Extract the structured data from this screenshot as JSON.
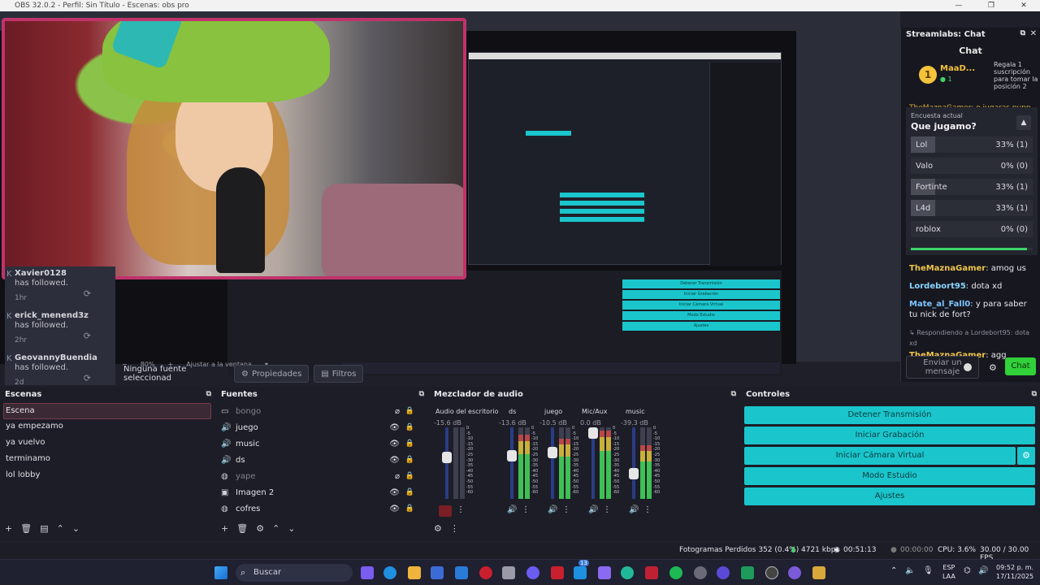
{
  "window": {
    "title": "OBS 32.0.2 - Perfil: Sin Título - Escenas: obs pro",
    "controls": [
      "—",
      "❐",
      "✕"
    ]
  },
  "preview": {
    "zoom": "80%",
    "fit_label": "Ajustar a la ventana"
  },
  "alerts": [
    {
      "name": "Xavier0128",
      "text": "has followed.",
      "ago": "1hr"
    },
    {
      "name": "erick_menend3z",
      "text": "has followed.",
      "ago": "2hr"
    },
    {
      "name": "GeovannyBuendia",
      "text": "has followed.",
      "ago": "2d"
    }
  ],
  "source_bar": {
    "no_source": "Ninguna fuente seleccionad",
    "properties": "Propiedades",
    "filters": "Filtros"
  },
  "chat": {
    "dock_title": "Streamlabs: Chat",
    "title": "Chat",
    "pinned": {
      "name": "MaaD...",
      "count": "1",
      "reward": "Regala 1 suscripción para tomar la posición 2"
    },
    "partial_line": "TheMaznaGamer: o jugaras puppy",
    "poll": {
      "label": "Encuesta actual",
      "question": "Que jugamo?",
      "options": [
        {
          "name": "Lol",
          "value": "33% (1)",
          "pct": 33
        },
        {
          "name": "Valo",
          "value": "0% (0)",
          "pct": 0
        },
        {
          "name": "Fortinte",
          "value": "33% (1)",
          "pct": 33
        },
        {
          "name": "L4d",
          "value": "33% (1)",
          "pct": 33
        },
        {
          "name": "roblox",
          "value": "0% (0)",
          "pct": 0
        }
      ],
      "progress": 0.95
    },
    "messages": [
      {
        "user": "TheMaznaGamer",
        "text": "amog us"
      },
      {
        "user": "Lordebort95",
        "text": "dota xd"
      },
      {
        "user": "Mate_al_Fall0",
        "text": "y para saber tu nick de fort?"
      }
    ],
    "reply_hint": "Respondiendo a Lordebort95: dota xd",
    "reply": {
      "user": "TheMaznaGamer",
      "text": "agg"
    },
    "input_placeholder": "Enviar un mensaje",
    "send_label": "Chat"
  },
  "scenes": {
    "title": "Escenas",
    "items": [
      "Escena",
      "ya empezamo",
      "ya vuelvo",
      "terminamo",
      "lol lobby"
    ],
    "selected": 0
  },
  "sources": {
    "title": "Fuentes",
    "items": [
      {
        "name": "bongo",
        "icon": "window-icon",
        "visible": false
      },
      {
        "name": "juego",
        "icon": "speaker-icon",
        "visible": true
      },
      {
        "name": "music",
        "icon": "speaker-icon",
        "visible": true
      },
      {
        "name": "ds",
        "icon": "speaker-icon",
        "visible": true
      },
      {
        "name": "yape",
        "icon": "globe-icon",
        "visible": false
      },
      {
        "name": "Imagen 2",
        "icon": "image-icon",
        "visible": true
      },
      {
        "name": "cofres",
        "icon": "globe-icon",
        "visible": true
      }
    ]
  },
  "mixer": {
    "title": "Mezclador de audio",
    "channels": [
      {
        "name": "Audio del escritorio",
        "db": "-15.6 dB",
        "level": 0.0,
        "muted": true
      },
      {
        "name": "ds",
        "db": "-13.6 dB",
        "level": 0.9,
        "muted": false
      },
      {
        "name": "juego",
        "db": "-10.5 dB",
        "level": 0.85,
        "muted": false
      },
      {
        "name": "Mic/Aux",
        "db": "0.0 dB",
        "level": 0.95,
        "muted": false
      },
      {
        "name": "music",
        "db": "-39.3 dB",
        "level": 0.75,
        "muted": false
      }
    ],
    "scale": [
      "0",
      "-5",
      "-10",
      "-15",
      "-20",
      "-25",
      "-30",
      "-35",
      "-40",
      "-45",
      "-50",
      "-55",
      "-60"
    ]
  },
  "controls": {
    "title": "Controles",
    "buttons": [
      "Detener Transmisión",
      "Iniciar Grabación",
      "Iniciar Cámara Virtual",
      "Modo Estudio",
      "Ajustes"
    ]
  },
  "status": {
    "dropped": "Fotogramas Perdidos 352 (0.4%)",
    "bitrate": "4721 kbps",
    "stream_time": "00:51:13",
    "rec_time": "00:00:00",
    "cpu": "CPU: 3.6%",
    "fps": "30.00 / 30.00 FPS"
  },
  "taskbar": {
    "search": "Buscar",
    "lang_top": "ESP",
    "lang_bottom": "LAA",
    "time": "09:52 p. m.",
    "date": "17/11/2025",
    "badge": "13"
  }
}
